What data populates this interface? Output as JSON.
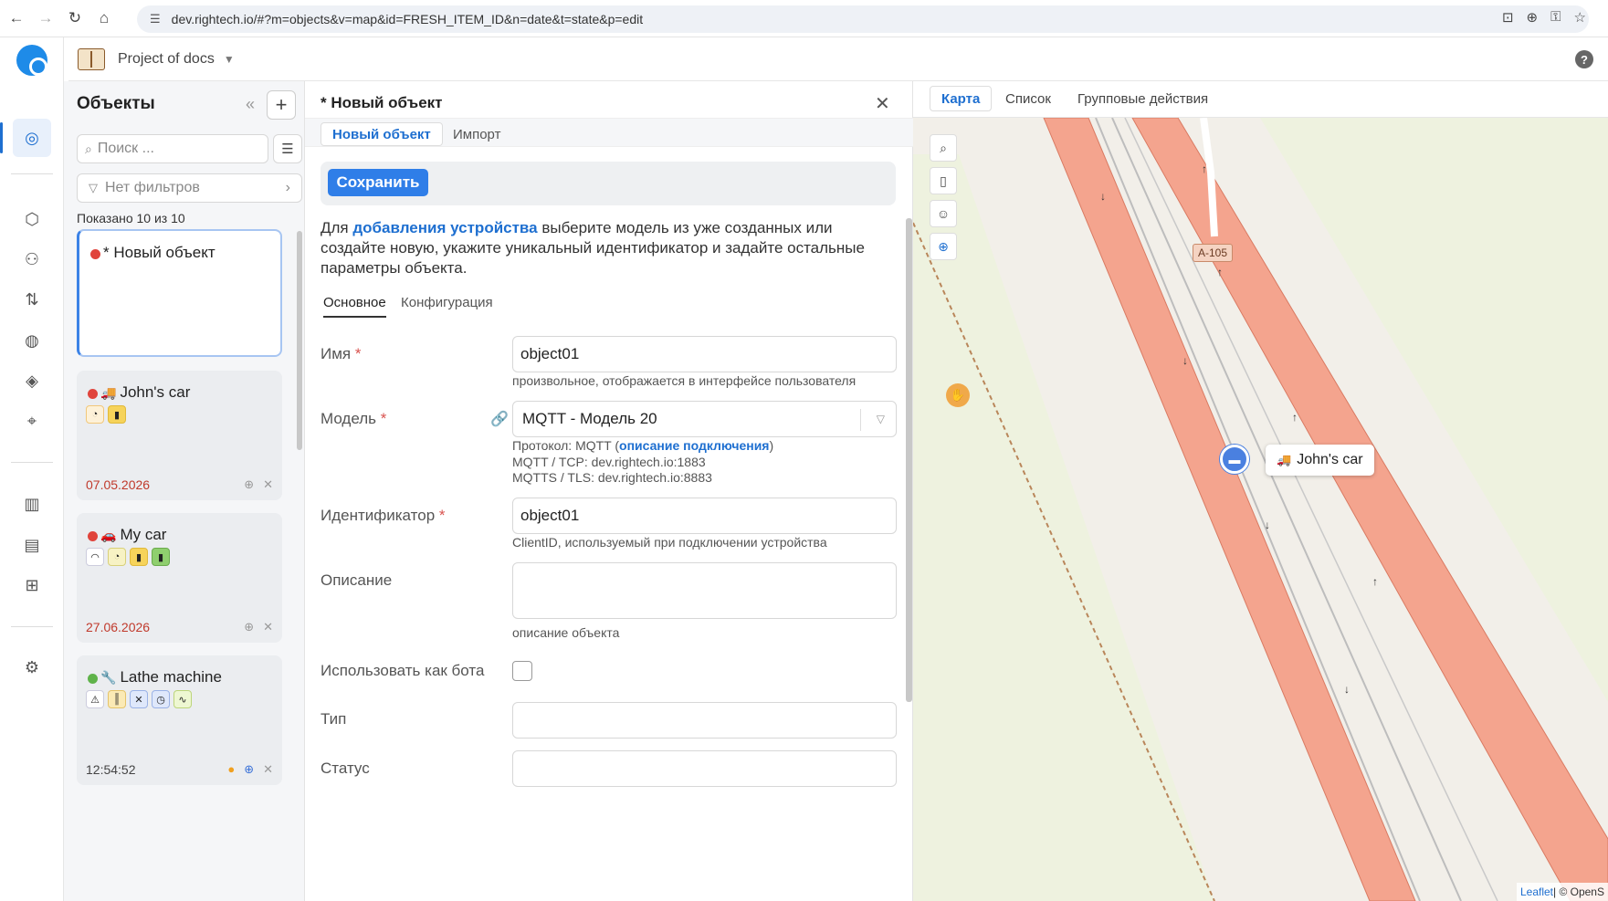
{
  "browser": {
    "url": "dev.rightech.io/#?m=objects&v=map&id=FRESH_ITEM_ID&n=date&t=state&p=edit"
  },
  "app": {
    "project_name": "Project of docs",
    "help": "?"
  },
  "objects_panel": {
    "title": "Объекты",
    "search_placeholder": "Поиск ...",
    "filters_label": "Нет фильтров",
    "shown_count": "Показано 10 из 10",
    "items": [
      {
        "name": "* Новый объект",
        "status_color": "#e0443c",
        "date": ""
      },
      {
        "name": "John's car",
        "emoji": "🚚",
        "status_color": "#e0443c",
        "date": "07.05.2026"
      },
      {
        "name": "My car",
        "emoji": "🚗",
        "status_color": "#e0443c",
        "date": "27.06.2026"
      },
      {
        "name": "Lathe machine",
        "emoji": "🔧",
        "status_color": "#5fb34a",
        "date": "12:54:52"
      }
    ]
  },
  "form": {
    "title": "* Новый объект",
    "subtabs": [
      "Новый объект",
      "Импорт"
    ],
    "save_label": "Сохранить",
    "intro_before": "Для ",
    "intro_link": "добавления устройства",
    "intro_after": " выберите модель из уже созданных или создайте новую, укажите уникальный идентификатор и задайте остальные параметры объекта.",
    "inner_tabs": [
      "Основное",
      "Конфигурация"
    ],
    "name_label": "Имя",
    "name_value": "object01",
    "name_hint": "произвольное, отображается в интерфейсе пользователя",
    "model_label": "Модель",
    "model_value": "MQTT - Модель 20",
    "protocol_prefix": "Протокол: MQTT (",
    "protocol_link": "описание подключения",
    "protocol_suffix": ")",
    "mqtt_tcp": "MQTT / TCP: dev.rightech.io:1883",
    "mqtts_tls": "MQTTS / TLS: dev.rightech.io:8883",
    "identifier_label": "Идентификатор",
    "identifier_value": "object01",
    "identifier_hint": "ClientID, используемый при подключении устройства",
    "description_label": "Описание",
    "description_hint": "описание объекта",
    "bot_label": "Использовать как бота",
    "type_label": "Тип",
    "status_label": "Статус",
    "required_mark": "*"
  },
  "map": {
    "tabs": [
      "Карта",
      "Список",
      "Групповые действия"
    ],
    "road_label": "А-105",
    "car_label": "John's car",
    "car_emoji": "🚚",
    "attribution_link": "Leaflet",
    "attribution_text": " | © OpenS"
  },
  "colors": {
    "accent": "#2f7ee8",
    "road": "#f4a48e",
    "map_bg": "#f2efe9",
    "field_green": "#eef2df"
  }
}
